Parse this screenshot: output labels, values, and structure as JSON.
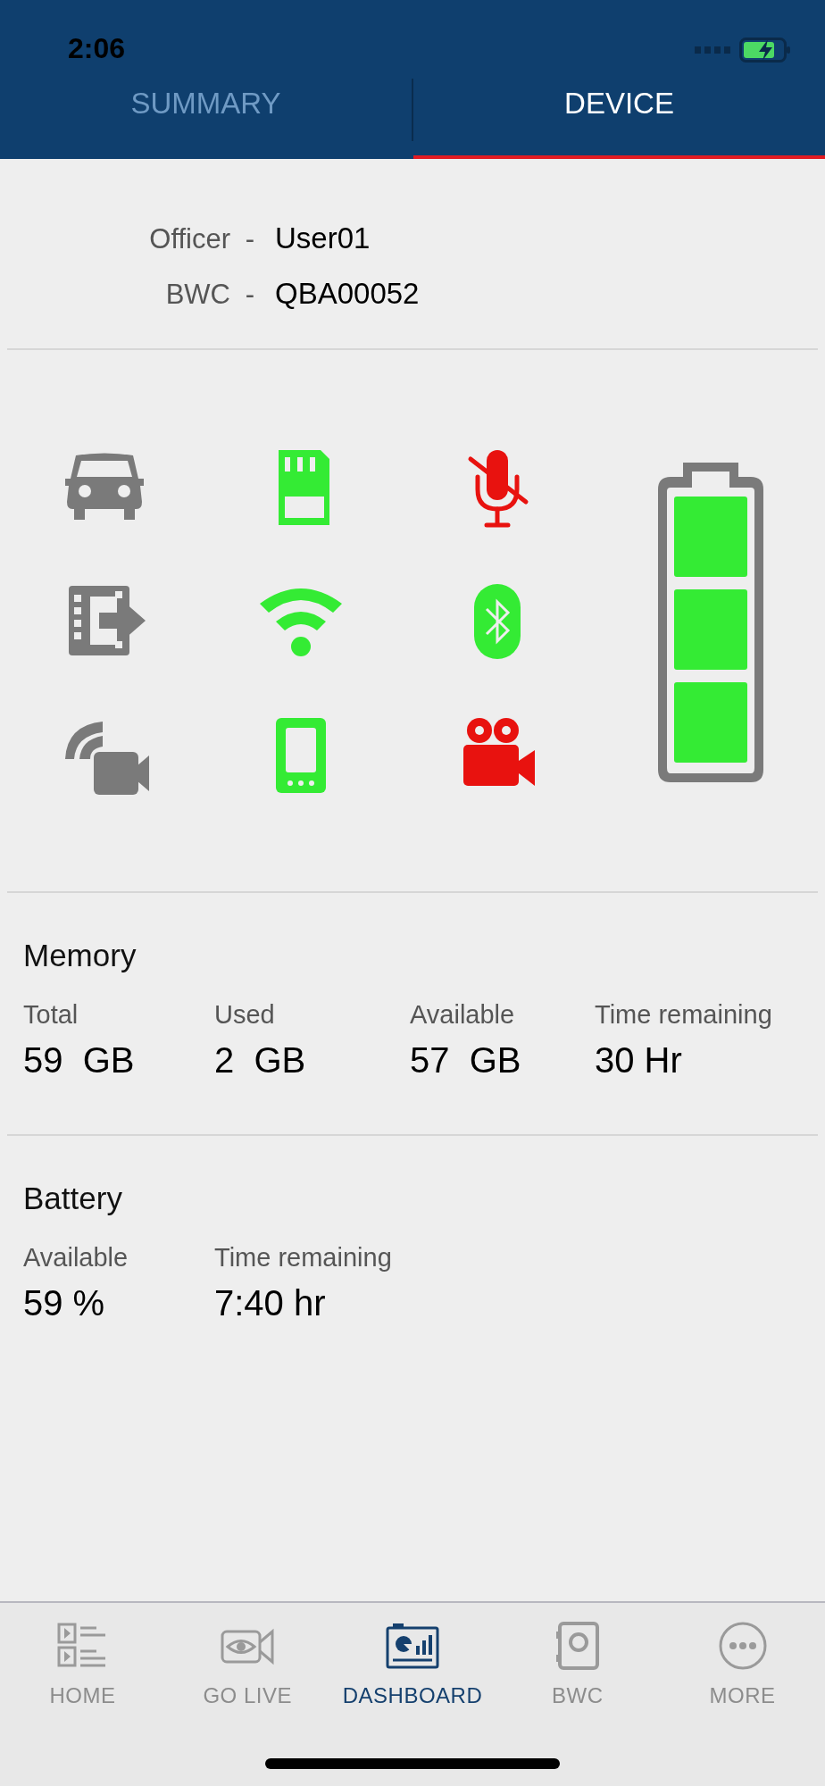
{
  "status_bar": {
    "time": "2:06"
  },
  "tabs": [
    {
      "label": "SUMMARY",
      "selected": false
    },
    {
      "label": "DEVICE",
      "selected": true
    }
  ],
  "identity": [
    {
      "label": "Officer",
      "separator": "-",
      "value": "User01"
    },
    {
      "label": "BWC",
      "separator": "-",
      "value": "QBA00052"
    }
  ],
  "device_icons": [
    {
      "kind": "car",
      "color": "#7a7a7a"
    },
    {
      "kind": "sd-card",
      "color": "#34eb34"
    },
    {
      "kind": "mic-off",
      "color": "#e8120f"
    },
    {
      "kind": "film-export",
      "color": "#7a7a7a"
    },
    {
      "kind": "wifi",
      "color": "#34eb34"
    },
    {
      "kind": "bluetooth",
      "color": "#34eb34"
    },
    {
      "kind": "wireless-camera",
      "color": "#7a7a7a"
    },
    {
      "kind": "tablet",
      "color": "#34eb34"
    },
    {
      "kind": "video-camera",
      "color": "#e8120f"
    }
  ],
  "memory": {
    "title": "Memory",
    "stats": [
      {
        "label": "Total",
        "value": "59  GB"
      },
      {
        "label": "Used",
        "value": "2  GB"
      },
      {
        "label": "Available",
        "value": "57  GB"
      },
      {
        "label": "Time remaining",
        "value": "30 Hr"
      }
    ]
  },
  "battery": {
    "title": "Battery",
    "stats": [
      {
        "label": "Available",
        "value": "59 %"
      },
      {
        "label": "Time remaining",
        "value": "7:40 hr"
      }
    ]
  },
  "bottom_nav": [
    {
      "kind": "home",
      "label": "HOME",
      "selected": false
    },
    {
      "kind": "live",
      "label": "GO LIVE",
      "selected": false
    },
    {
      "kind": "dashboard",
      "label": "DASHBOARD",
      "selected": true
    },
    {
      "kind": "bwc",
      "label": "BWC",
      "selected": false
    },
    {
      "kind": "more",
      "label": "MORE",
      "selected": false
    }
  ]
}
